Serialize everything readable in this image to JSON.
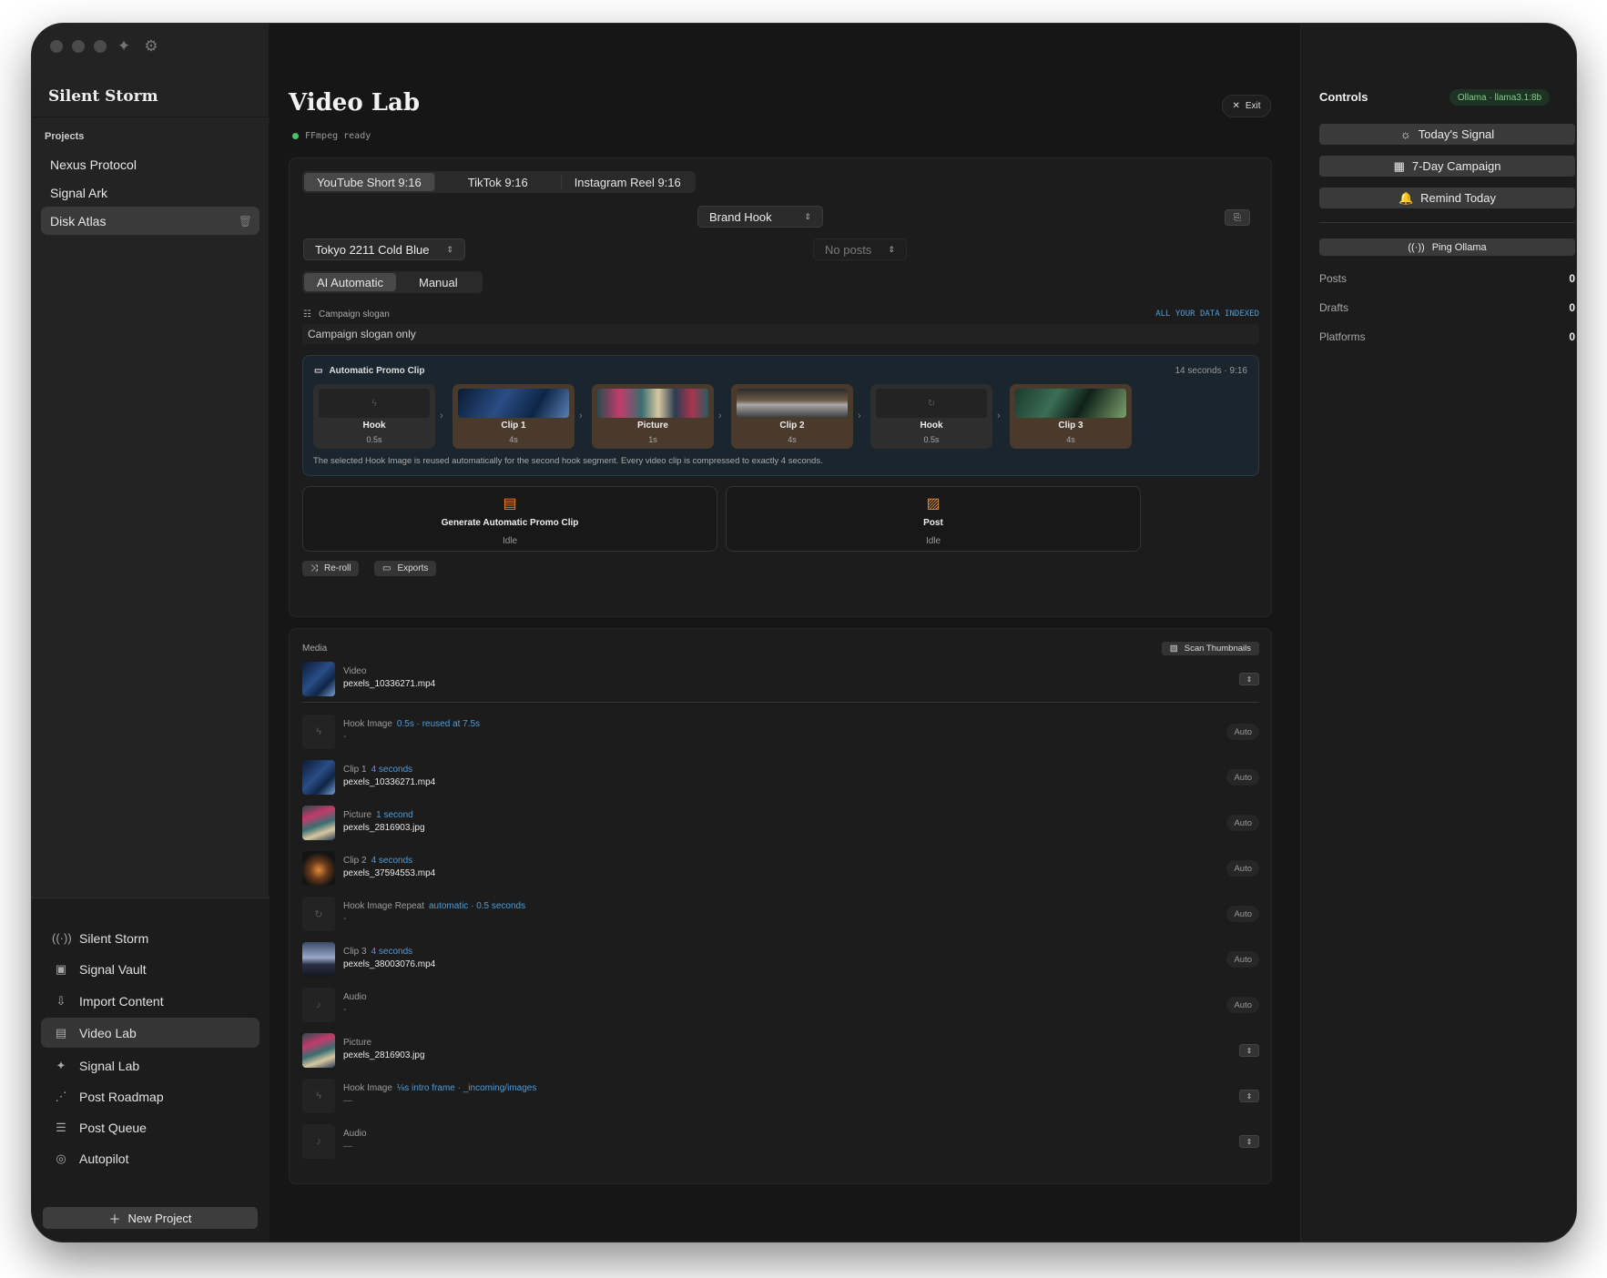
{
  "sidebar": {
    "brand": "Silent Storm",
    "projects_label": "Projects",
    "projects": [
      {
        "label": "Nexus Protocol"
      },
      {
        "label": "Signal Ark"
      },
      {
        "label": "Disk Atlas",
        "active": true
      }
    ],
    "nav": [
      {
        "label": "Silent Storm",
        "icon": "broadcast-icon"
      },
      {
        "label": "Signal Vault",
        "icon": "vault-icon"
      },
      {
        "label": "Import Content",
        "icon": "import-icon"
      },
      {
        "label": "Video Lab",
        "icon": "film-icon",
        "active": true
      },
      {
        "label": "Signal Lab",
        "icon": "sparkle-icon"
      },
      {
        "label": "Post Roadmap",
        "icon": "roadmap-icon"
      },
      {
        "label": "Post Queue",
        "icon": "queue-icon"
      },
      {
        "label": "Autopilot",
        "icon": "autopilot-icon"
      }
    ],
    "new_project": "New Project"
  },
  "main": {
    "title": "Video Lab",
    "status": "FFmpeg ready",
    "exit_label": "Exit",
    "format_tabs": [
      {
        "label": "YouTube Short 9:16",
        "active": true
      },
      {
        "label": "TikTok 9:16"
      },
      {
        "label": "Instagram Reel 9:16"
      }
    ],
    "hook_select": "Brand Hook",
    "theme_select": "Tokyo 2211 Cold Blue",
    "posts_select": "No posts",
    "mode_tabs": [
      {
        "label": "AI Automatic",
        "active": true
      },
      {
        "label": "Manual"
      }
    ],
    "slogan_label": "Campaign slogan",
    "indexed_label": "ALL YOUR DATA INDEXED",
    "slogan_value": "Campaign slogan only",
    "promo": {
      "title": "Automatic Promo Clip",
      "meta": "14 seconds · 9:16",
      "segments": [
        {
          "name": "Hook",
          "dur": "0.5s"
        },
        {
          "name": "Clip 1",
          "dur": "4s"
        },
        {
          "name": "Picture",
          "dur": "1s"
        },
        {
          "name": "Clip 2",
          "dur": "4s"
        },
        {
          "name": "Hook",
          "dur": "0.5s"
        },
        {
          "name": "Clip 3",
          "dur": "4s"
        }
      ],
      "note": "The selected Hook Image is reused automatically for the second hook segment. Every video clip is compressed to exactly 4 seconds."
    },
    "actions": [
      {
        "title": "Generate Automatic Promo Clip",
        "status": "Idle"
      },
      {
        "title": "Post",
        "status": "Idle"
      }
    ],
    "reroll_label": "Re-roll",
    "exports_label": "Exports",
    "media": {
      "label": "Media",
      "scan_label": "Scan Thumbnails",
      "rows": [
        {
          "type": "Video",
          "hl": "",
          "file": "pexels_10336271.mp4",
          "ctl": "stepper"
        },
        {
          "type": "Hook Image",
          "hl": "0.5s · reused at 7.5s",
          "file": "-",
          "ctl": "auto"
        },
        {
          "type": "Clip 1",
          "hl": "4 seconds",
          "file": "pexels_10336271.mp4",
          "ctl": "auto"
        },
        {
          "type": "Picture",
          "hl": "1 second",
          "file": "pexels_2816903.jpg",
          "ctl": "auto"
        },
        {
          "type": "Clip 2",
          "hl": "4 seconds",
          "file": "pexels_37594553.mp4",
          "ctl": "auto"
        },
        {
          "type": "Hook Image Repeat",
          "hl": "automatic · 0.5 seconds",
          "file": "-",
          "ctl": "auto"
        },
        {
          "type": "Clip 3",
          "hl": "4 seconds",
          "file": "pexels_38003076.mp4",
          "ctl": "auto"
        },
        {
          "type": "Audio",
          "hl": "",
          "file": "-",
          "ctl": "auto"
        },
        {
          "type": "Picture",
          "hl": "",
          "file": "pexels_2816903.jpg",
          "ctl": "stepper"
        },
        {
          "type": "Hook Image",
          "hl": "⅛s intro frame · _incoming/images",
          "file": "—",
          "ctl": "stepper"
        },
        {
          "type": "Audio",
          "hl": "",
          "file": "—",
          "ctl": "stepper"
        }
      ],
      "auto_label": "Auto"
    }
  },
  "controls": {
    "title": "Controls",
    "model": "Ollama · llama3.1:8b",
    "buttons": [
      {
        "label": "Today's Signal"
      },
      {
        "label": "7-Day Campaign"
      },
      {
        "label": "Remind Today"
      }
    ],
    "ping": "Ping Ollama",
    "stats": [
      {
        "label": "Posts",
        "value": "0"
      },
      {
        "label": "Drafts",
        "value": "0"
      },
      {
        "label": "Platforms",
        "value": "0"
      }
    ]
  },
  "colors": {
    "accent": "#4d9cd8",
    "ready": "#47c46a",
    "action_icon": "#e08a3c"
  }
}
